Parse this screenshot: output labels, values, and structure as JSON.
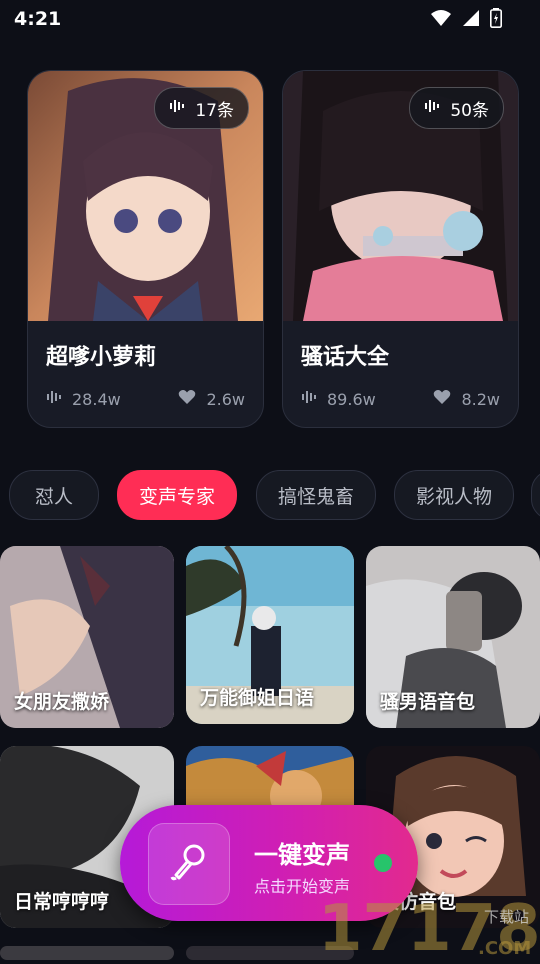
{
  "status_bar": {
    "time": "4:21"
  },
  "featured": [
    {
      "title": "超嗲小萝莉",
      "count": "17条",
      "plays": "28.4w",
      "likes": "2.6w"
    },
    {
      "title": "骚话大全",
      "count": "50条",
      "plays": "89.6w",
      "likes": "8.2w"
    }
  ],
  "categories": [
    {
      "label": "怼人",
      "active": false
    },
    {
      "label": "变声专家",
      "active": true
    },
    {
      "label": "搞怪鬼畜",
      "active": false
    },
    {
      "label": "影视人物",
      "active": false
    }
  ],
  "tiles": [
    {
      "label": "女朋友撒娇"
    },
    {
      "label": "万能御姐日语"
    },
    {
      "label": "骚男语音包"
    },
    {
      "label": "日常哼哼哼"
    },
    {
      "label": ""
    },
    {
      "label": "模仿音包"
    }
  ],
  "fab": {
    "title": "一键变声",
    "subtitle": "点击开始变声"
  },
  "watermark": {
    "main": "17178",
    "site": "下载站",
    "suffix": ".COM"
  },
  "colors": {
    "accent": "#ff2d55",
    "fab_start": "#b51ad8",
    "fab_end": "#e22a8e",
    "online_dot": "#27c46b"
  }
}
